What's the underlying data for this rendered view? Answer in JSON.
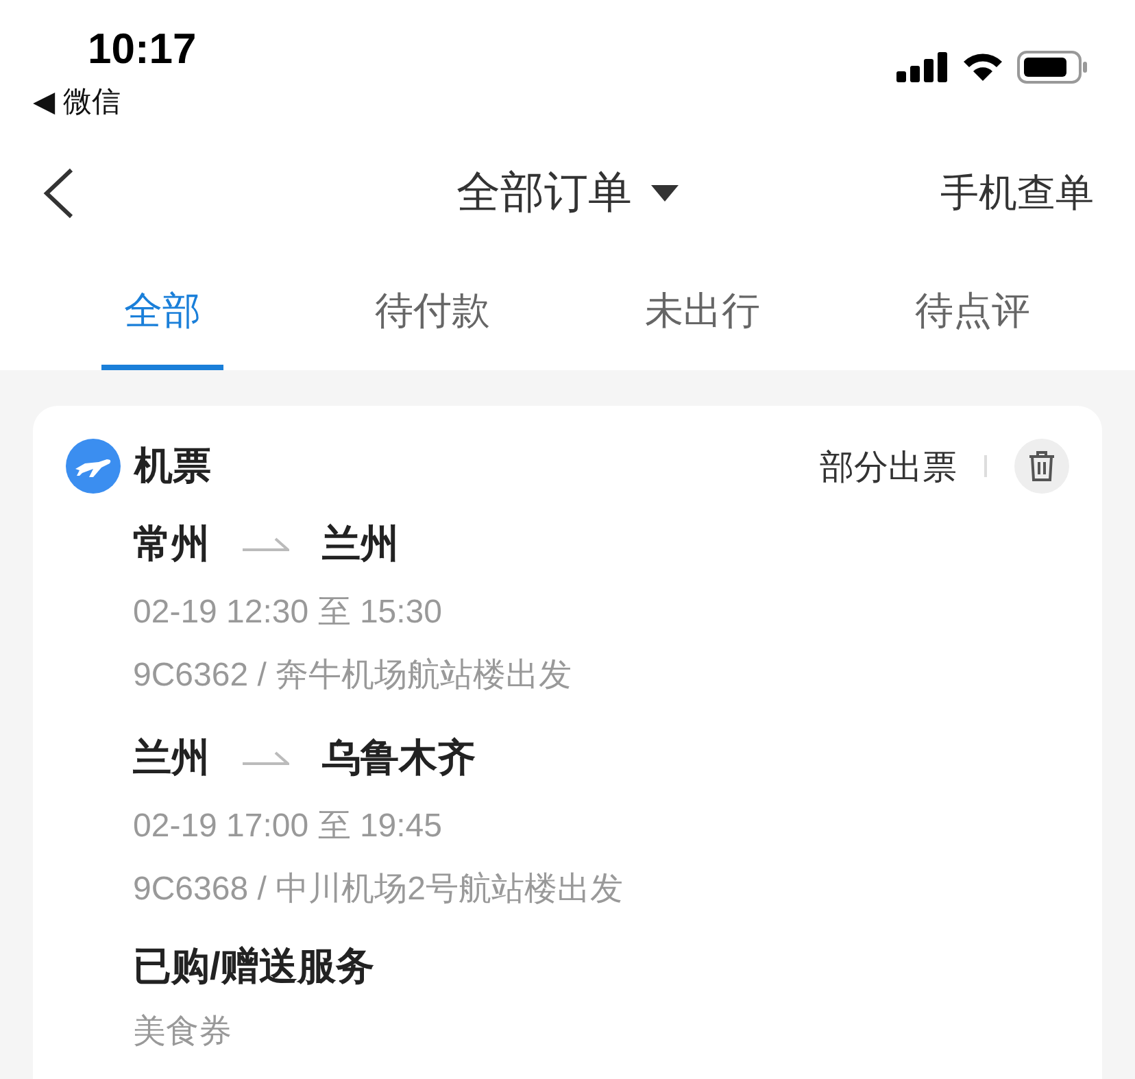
{
  "status_bar": {
    "time": "10:17",
    "back_app": "◀ 微信"
  },
  "nav": {
    "title": "全部订单",
    "right": "手机查单"
  },
  "tabs": [
    {
      "label": "全部",
      "selected": true
    },
    {
      "label": "待付款",
      "selected": false
    },
    {
      "label": "未出行",
      "selected": false
    },
    {
      "label": "待点评",
      "selected": false
    }
  ],
  "order": {
    "type": "机票",
    "status": "部分出票",
    "segments": [
      {
        "from": "常州",
        "to": "兰州",
        "time": "02-19 12:30 至 15:30",
        "flight": "9C6362 / 奔牛机场航站楼出发"
      },
      {
        "from": "兰州",
        "to": "乌鲁木齐",
        "time": "02-19 17:00 至 19:45",
        "flight": "9C6368 / 中川机场2号航站楼出发"
      }
    ],
    "services_title": "已购/赠送服务",
    "services": [
      "美食券"
    ]
  }
}
